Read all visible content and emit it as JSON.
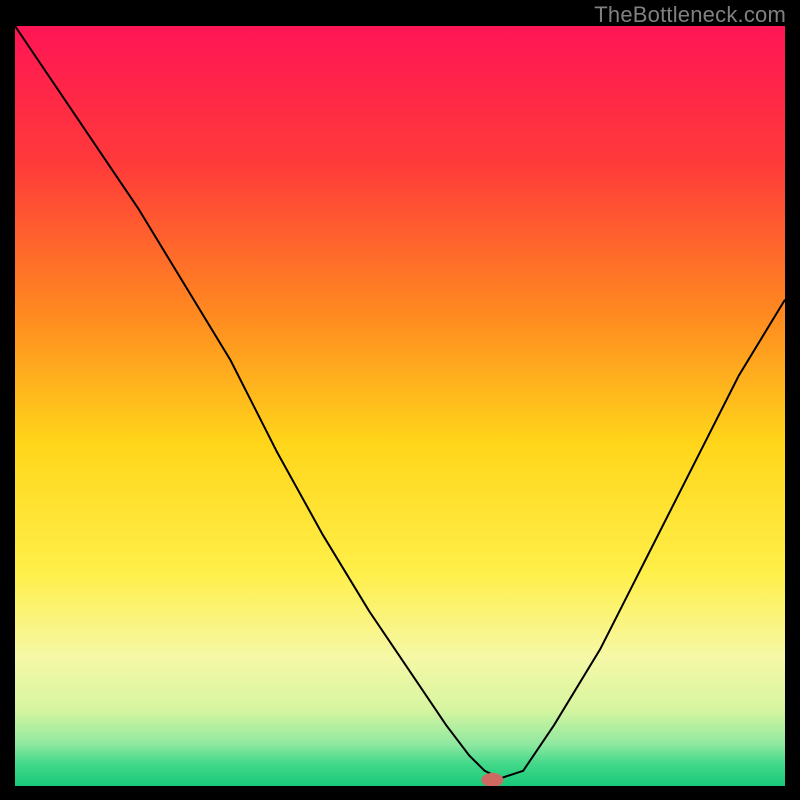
{
  "watermark": "TheBottleneck.com",
  "chart_data": {
    "type": "line",
    "title": "",
    "xlabel": "",
    "ylabel": "",
    "xlim": [
      0,
      100
    ],
    "ylim": [
      0,
      100
    ],
    "grid": false,
    "legend": false,
    "gradient_stops": [
      {
        "pos": 0.0,
        "color": "#ff1555"
      },
      {
        "pos": 0.18,
        "color": "#ff3a3a"
      },
      {
        "pos": 0.38,
        "color": "#ff8a20"
      },
      {
        "pos": 0.55,
        "color": "#ffd61a"
      },
      {
        "pos": 0.72,
        "color": "#ffef4a"
      },
      {
        "pos": 0.83,
        "color": "#f6f8a6"
      },
      {
        "pos": 0.9,
        "color": "#d6f5a0"
      },
      {
        "pos": 0.945,
        "color": "#8fe8a0"
      },
      {
        "pos": 0.97,
        "color": "#44d98a"
      },
      {
        "pos": 1.0,
        "color": "#17c87a"
      }
    ],
    "series": [
      {
        "name": "bottleneck-curve",
        "x": [
          0,
          8,
          16,
          22,
          28,
          34,
          40,
          46,
          52,
          56,
          59,
          61,
          63,
          66,
          70,
          76,
          82,
          88,
          94,
          100
        ],
        "y": [
          100,
          88,
          76,
          66,
          56,
          44,
          33,
          23,
          14,
          8,
          4,
          2,
          1,
          2,
          8,
          18,
          30,
          42,
          54,
          64
        ]
      }
    ],
    "marker": {
      "x": 62,
      "y": 0.8,
      "color": "#cf6a62",
      "rx": 11,
      "ry": 7
    }
  }
}
